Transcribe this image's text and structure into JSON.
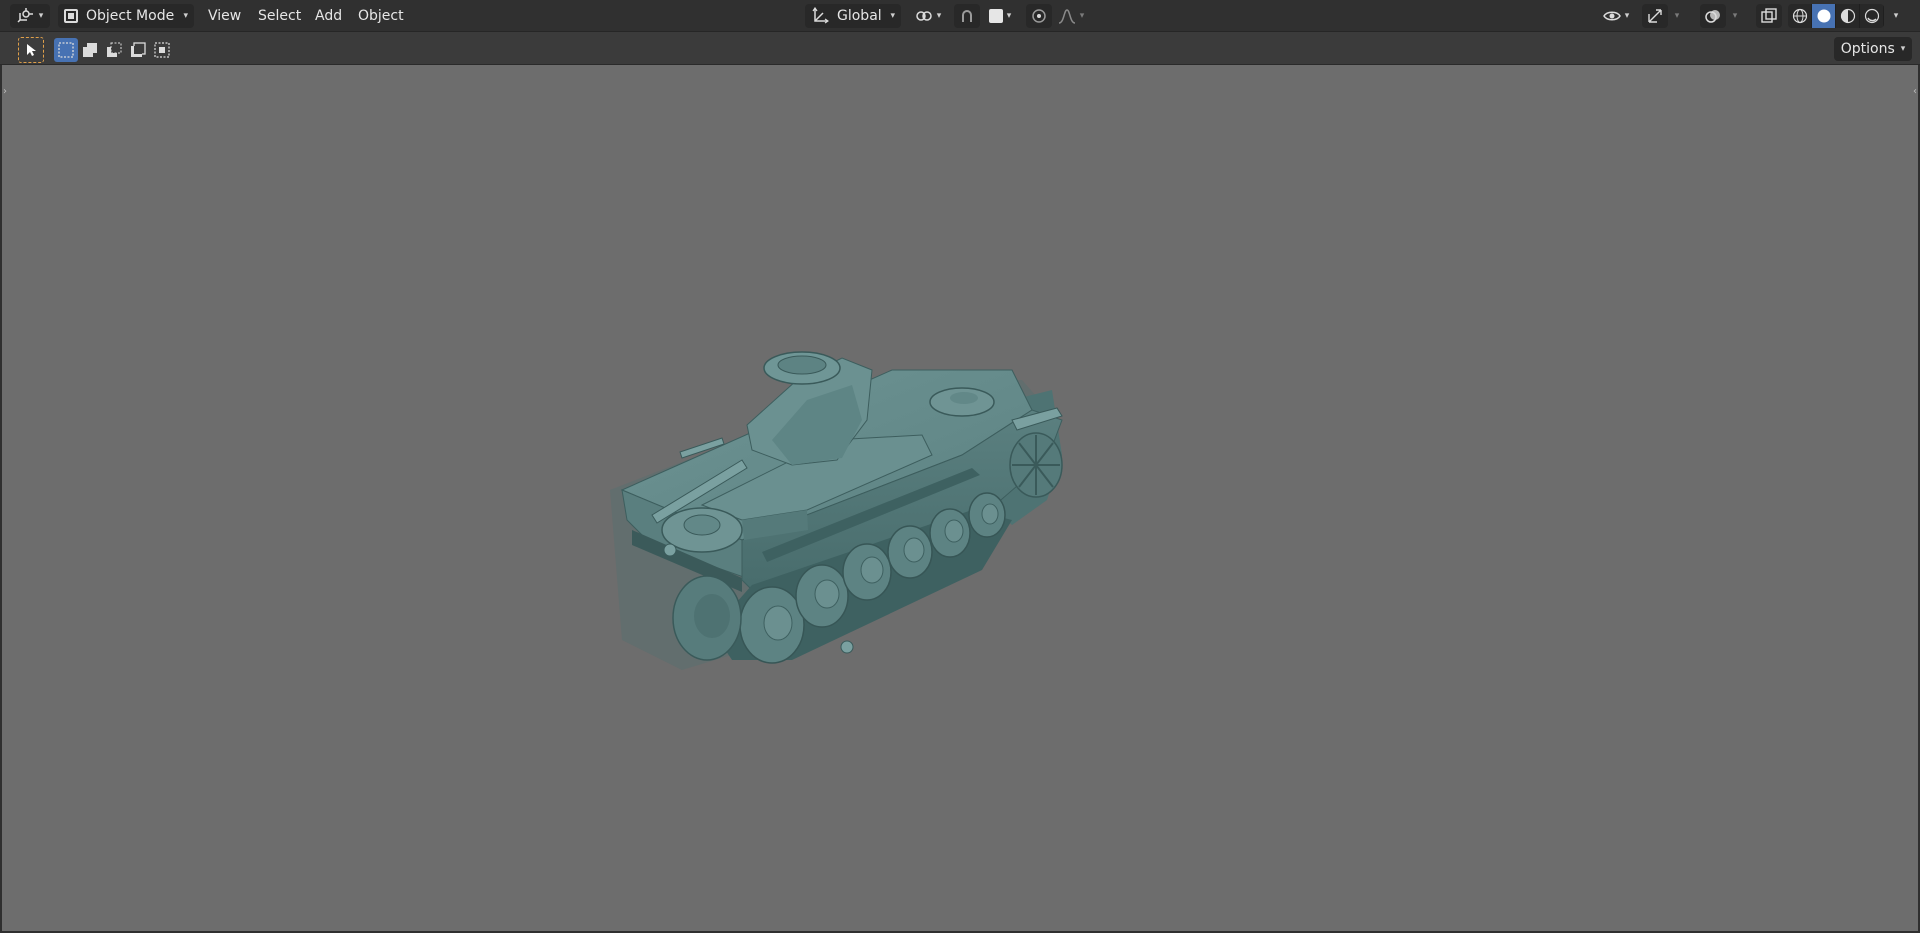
{
  "header": {
    "editor_type_icon": "view3d-icon",
    "mode_label": "Object Mode",
    "menus": [
      "View",
      "Select",
      "Add",
      "Object"
    ],
    "transform_orientation": "Global",
    "shading_active": "solid"
  },
  "toolbar": {
    "options_label": "Options"
  },
  "colors": {
    "header_bg": "#303030",
    "toolbar_bg": "#3b3b3b",
    "viewport_bg": "#6d6d6d",
    "accent": "#4772b3",
    "tank_body": "#5f8686"
  }
}
